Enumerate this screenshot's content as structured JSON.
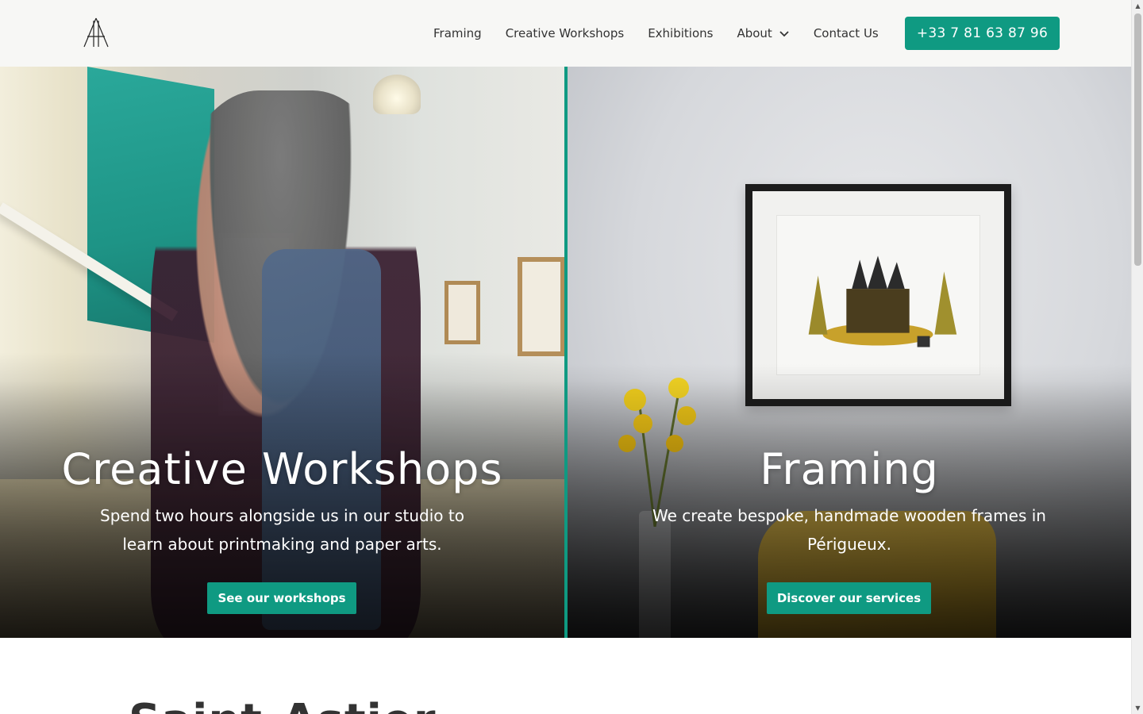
{
  "nav": {
    "items": [
      "Framing",
      "Creative Workshops",
      "Exhibitions",
      "About",
      "Contact Us"
    ],
    "about_dropdown_icon": "chevron-down-icon",
    "phone": "+33 7 81 63 87 96"
  },
  "hero": {
    "left": {
      "title": "Creative Workshops",
      "description": "Spend two hours alongside us in our studio to learn about printmaking and paper arts.",
      "button": "See our workshops"
    },
    "right": {
      "title": "Framing",
      "description": "We create bespoke, handmade wooden frames in Périgueux.",
      "button": "Discover our services"
    }
  },
  "below": {
    "title": "Saint-Astier"
  },
  "colors": {
    "accent": "#0f9a82",
    "header_bg": "#f7f7f5"
  }
}
